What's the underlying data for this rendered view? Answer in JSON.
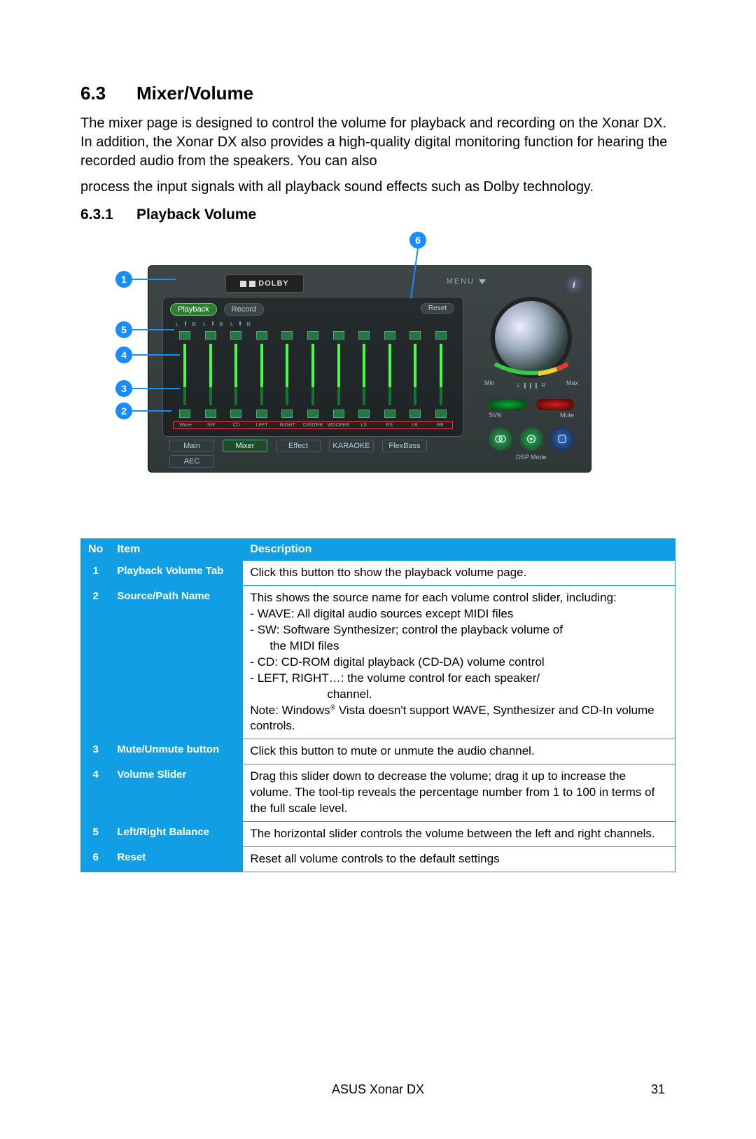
{
  "section": {
    "num": "6.3",
    "title": "Mixer/Volume"
  },
  "para1": "The mixer page is designed to control the volume for playback and recording on the Xonar DX. In addition, the Xonar DX also provides a high-quality digital monitoring function for hearing the recorded audio from the speakers. You can also",
  "para2": "process the input signals with all playback sound effects such as Dolby technology.",
  "subsection": {
    "num": "6.3.1",
    "title": "Playback Volume"
  },
  "callouts": {
    "c1": "1",
    "c2": "2",
    "c3": "3",
    "c4": "4",
    "c5": "5",
    "c6": "6"
  },
  "ui": {
    "dolby": "DOLBY",
    "menu": "MENU",
    "playback": "Playback",
    "record": "Record",
    "reset": "Reset",
    "sources": [
      "Wave",
      "SW",
      "CD",
      "LEFT",
      "RIGHT",
      "CENTER",
      "WOOFER",
      "LS",
      "RS",
      "LB",
      "RB"
    ],
    "tabs": [
      "Main",
      "Mixer",
      "Effect",
      "KARAOKE",
      "FlexBass"
    ],
    "tabs2": [
      "AEC"
    ],
    "min": "Min",
    "max": "Max",
    "L": "L",
    "R": "R",
    "svn": "SVN",
    "mute": "Mute",
    "dsp": "DSP Mode"
  },
  "table": {
    "headers": {
      "no": "No",
      "item": "Item",
      "desc": "Description"
    },
    "rows": [
      {
        "no": "1",
        "item": "Playback Volume Tab",
        "desc": "Click this button tto show the playback volume page."
      },
      {
        "no": "2",
        "item": "Source/Path Name",
        "desc_l1": "This shows the source name for each volume control slider, including:",
        "desc_l2": "- WAVE: All digital audio sources except MIDI files",
        "desc_l3": "- SW: Software Synthesizer; control the playback volume of",
        "desc_l3b": "the MIDI files",
        "desc_l4": "- CD: CD-ROM digital playback (CD-DA) volume control",
        "desc_l5": "- LEFT, RIGHT…: the volume control for each speaker/",
        "desc_l5b": "channel.",
        "desc_l6a": "Note: Windows",
        "desc_l6b": " Vista doesn't support WAVE, Synthesizer and CD-In volume controls."
      },
      {
        "no": "3",
        "item": "Mute/Unmute button",
        "desc": "Click this button to mute or unmute the audio channel."
      },
      {
        "no": "4",
        "item": "Volume Slider",
        "desc": "Drag this slider down to decrease the volume; drag it up to increase the volume. The tool-tip reveals the percentage number from 1 to 100 in terms of the full scale level."
      },
      {
        "no": "5",
        "item": "Left/Right Balance",
        "desc": "The horizontal slider controls the volume between the left and right channels."
      },
      {
        "no": "6",
        "item": "Reset",
        "desc": "Reset all volume controls to the default settings"
      }
    ]
  },
  "footer": {
    "product": "ASUS Xonar DX",
    "page": "31"
  }
}
